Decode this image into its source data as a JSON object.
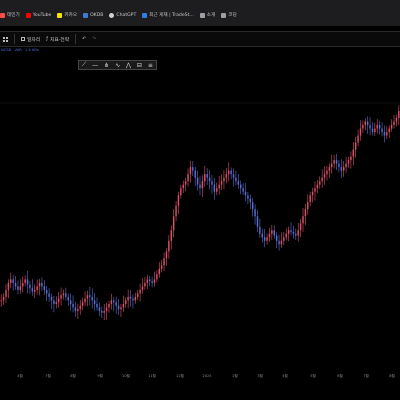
{
  "bookmarks": [
    {
      "label": "테민기",
      "color": "#ff4b4b"
    },
    {
      "label": "YouTube",
      "color": "#ff0000"
    },
    {
      "label": "카카오",
      "color": "#f7e600"
    },
    {
      "label": "OKDB",
      "color": "#3a7bd5"
    },
    {
      "label": "ChatGPT",
      "color": "#d0d0d0"
    },
    {
      "label": "최근 게재 | TradeSt...",
      "color": "#2f7de1"
    },
    {
      "label": "소개",
      "color": "#9aa0a6"
    },
    {
      "label": "코딩",
      "color": "#9aa0a6"
    }
  ],
  "toolbar": {
    "grid_icon": "grid-icon",
    "layout_label": "일자리",
    "indicators_label": "지표·전략",
    "undo_icon": "undo-icon",
    "redo_icon": "redo-icon"
  },
  "info_line": "·NCSB · VAR · 1,6 60b",
  "drawing_toolbar": {
    "tools": [
      "line-tool-icon",
      "ray-tool-icon",
      "pitchfork-tool-icon",
      "brush-tool-icon",
      "pattern-tool-icon",
      "measure-tool-icon",
      "more-tool-icon"
    ]
  },
  "chart_data": {
    "type": "candlestick",
    "title": "",
    "x_tick_labels": [
      "4월",
      "7월",
      "8월",
      "9월",
      "10월",
      "11월",
      "12월",
      "2025",
      "2월",
      "3월",
      "4월",
      "5월",
      "6월",
      "7월",
      "8월"
    ],
    "y_range": [
      0,
      100
    ],
    "series": [
      {
        "values": [
          18,
          20,
          24,
          28,
          30,
          28,
          26,
          24,
          26,
          28,
          30,
          27,
          25,
          23,
          24,
          26,
          28,
          26,
          24,
          22,
          20,
          18,
          16,
          17,
          19,
          21,
          22,
          20,
          18,
          16,
          14,
          12,
          13,
          15,
          17,
          19,
          21,
          20,
          18,
          16,
          14,
          12,
          11,
          12,
          14,
          16,
          18,
          17,
          15,
          13,
          14,
          16,
          18,
          20,
          19,
          18,
          20,
          22,
          24,
          26,
          28,
          30,
          29,
          28,
          30,
          33,
          36,
          38,
          42,
          46,
          52,
          58,
          66,
          72,
          78,
          82,
          84,
          86,
          90,
          94,
          92,
          88,
          84,
          82,
          86,
          90,
          88,
          86,
          84,
          80,
          82,
          84,
          86,
          88,
          90,
          92,
          90,
          88,
          86,
          84,
          82,
          80,
          78,
          76,
          74,
          70,
          66,
          60,
          56,
          54,
          52,
          54,
          56,
          58,
          55,
          52,
          50,
          52,
          54,
          56,
          58,
          57,
          56,
          55,
          58,
          62,
          66,
          70,
          74,
          78,
          80,
          82,
          84,
          86,
          88,
          90,
          92,
          94,
          96,
          98,
          96,
          94,
          92,
          94,
          96,
          98,
          100,
          104,
          108,
          112,
          116,
          118,
          120,
          118,
          116,
          114,
          116,
          118,
          116,
          114,
          112,
          114,
          116,
          118,
          120,
          122,
          126
        ]
      }
    ]
  }
}
